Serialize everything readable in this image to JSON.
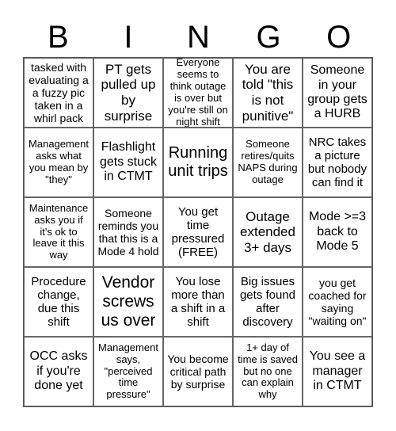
{
  "header": {
    "letters": [
      "B",
      "I",
      "N",
      "G",
      "O"
    ]
  },
  "cells": [
    "tasked with evaluating a a fuzzy pic taken in a whirl pack",
    "PT gets pulled up by surprise",
    "Everyone seems to think outage is over but you're still on night shift",
    "You are told \"this is not punitive\"",
    "Someone in your group gets a HURB",
    "Management asks what you mean by \"they\"",
    "Flashlight gets stuck in CTMT",
    "Running unit trips",
    "Someone retires/quits NAPS during outage",
    "NRC takes a picture but nobody can find it",
    "Maintenance asks you if it's ok to leave it this way",
    "Someone reminds you that this is a Mode 4 hold",
    "You get time pressured (FREE)",
    "Outage extended 3+ days",
    "Mode >=3 back to Mode 5",
    "Procedure change, due this shift",
    "Vendor screws us over",
    "You lose more than a shift in a shift",
    "Big issues gets found after discovery",
    "you get coached for saying \"waiting on\"",
    "OCC asks if you're done yet",
    "Management says, \"perceived time pressure\"",
    "You become critical path by surprise",
    "1+ day of time is saved but no one can explain why",
    "You see a manager in CTMT"
  ],
  "free_space_index": 12
}
